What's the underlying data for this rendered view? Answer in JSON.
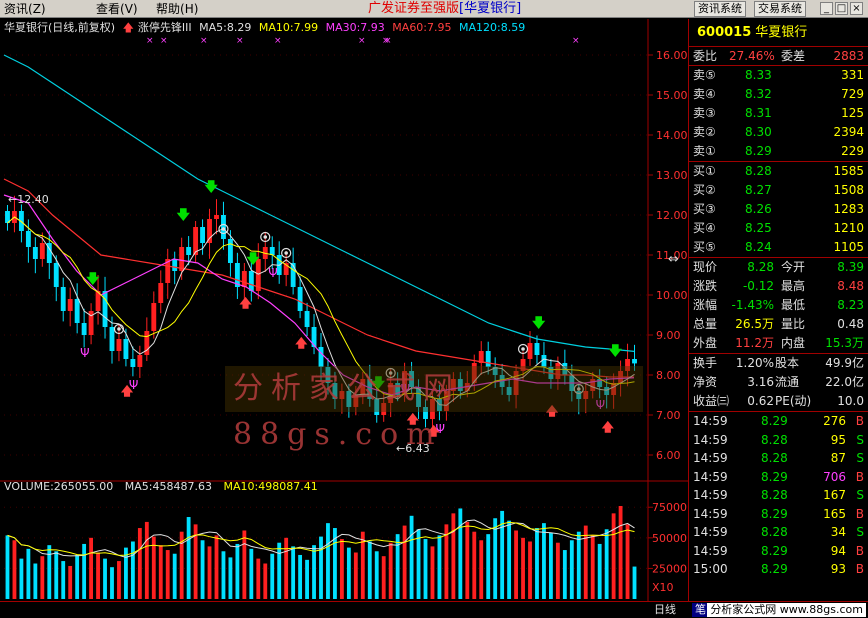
{
  "menubar": {
    "menus": [
      "资讯",
      "查看",
      "帮助"
    ],
    "menu_keys": [
      "(Z)",
      "(V)",
      "(H)"
    ],
    "banner": "广发证券至强版",
    "banner_stock": "[华夏银行]",
    "buttons": [
      "资讯系统",
      "交易系统"
    ],
    "win_buttons": [
      "_",
      "□",
      "×"
    ]
  },
  "chart": {
    "header": {
      "title": "华夏银行(日线,前复权)",
      "indicator": "涨停先锋III",
      "ma5": "MA5:8.29",
      "ma10": "MA10:7.99",
      "ma30": "MA30:7.93",
      "ma60": "MA60:7.95",
      "ma120": "MA120:8.59"
    },
    "price_axis": [
      "16.00",
      "15.00",
      "14.00",
      "13.00",
      "12.00",
      "11.00",
      "10.00",
      "9.00",
      "8.00",
      "7.00",
      "6.00"
    ],
    "high_label": "12.40",
    "low_label": "6.43",
    "volume_header": {
      "volume": "VOLUME:265055.00",
      "ma5": "MA5:458487.63",
      "ma10": "MA10:498087.41"
    },
    "volume_axis": [
      "75000",
      "50000",
      "25000"
    ],
    "volume_unit": "X10",
    "time_axis": [
      "2008年",
      "7",
      "8",
      "9",
      "10",
      "11",
      "12",
      "1"
    ],
    "watermark": "分析家公式网 88gs.com",
    "colors": {
      "up": "#ff2020",
      "down": "#00e0ff",
      "ma5": "#e0e0e0",
      "ma10": "#ffff00",
      "ma30": "#ff40ff",
      "ma60": "#ff3030",
      "ma120": "#00d0e0"
    }
  },
  "chart_data": {
    "type": "candlestick",
    "title": "华夏银行(日线,前复权)",
    "ylim": [
      5.6,
      16.5
    ],
    "high": 12.4,
    "low": 6.43,
    "ma_values": {
      "MA5": 8.29,
      "MA10": 7.99,
      "MA30": 7.93,
      "MA60": 7.95,
      "MA120": 8.59
    },
    "close_series": [
      11.8,
      12.1,
      11.6,
      11.2,
      10.9,
      11.3,
      10.8,
      10.2,
      9.6,
      9.9,
      9.3,
      9.0,
      9.6,
      10.1,
      9.2,
      8.6,
      8.9,
      8.4,
      8.2,
      8.5,
      9.1,
      9.8,
      10.3,
      10.9,
      10.6,
      11.2,
      11.0,
      11.7,
      11.3,
      11.9,
      12.0,
      11.4,
      10.8,
      10.2,
      10.6,
      10.1,
      10.9,
      11.2,
      11.0,
      10.5,
      10.8,
      10.2,
      9.6,
      9.2,
      8.7,
      8.2,
      7.8,
      7.4,
      7.6,
      7.2,
      7.5,
      7.9,
      7.4,
      7.0,
      7.3,
      7.8,
      7.5,
      8.1,
      7.7,
      7.2,
      6.9,
      7.4,
      7.1,
      7.6,
      7.9,
      7.6,
      7.8,
      8.3,
      8.6,
      8.2,
      8.0,
      7.7,
      7.5,
      8.1,
      8.4,
      8.8,
      8.5,
      8.2,
      7.9,
      8.3,
      8.0,
      7.6,
      7.4,
      7.6,
      7.9,
      7.7,
      7.5,
      7.8,
      8.1,
      8.4,
      8.29
    ],
    "ma120_series": [
      16.0,
      15.7,
      15.3,
      14.9,
      14.5,
      14.1,
      13.7,
      13.3,
      12.9,
      12.6,
      12.3,
      12.0,
      11.7,
      11.4,
      11.1,
      10.8,
      10.5,
      10.2,
      9.9,
      9.6,
      9.3,
      9.1,
      8.9,
      8.8,
      8.7,
      8.65,
      8.59
    ],
    "ma60_series": [
      12.9,
      12.6,
      12.0,
      11.5,
      11.0,
      10.9,
      10.8,
      10.7,
      10.6,
      10.5,
      10.3,
      10.1,
      9.9,
      9.6,
      9.3,
      9.0,
      8.8,
      8.6,
      8.5,
      8.4,
      8.3,
      8.2,
      8.1,
      8.0,
      8.0,
      7.95,
      7.95
    ],
    "ma30_series": [
      12.5,
      12.3,
      11.4,
      10.6,
      10.0,
      10.3,
      10.6,
      10.9,
      10.8,
      10.4,
      10.2,
      9.8,
      9.3,
      8.6,
      8.0,
      7.7,
      7.5,
      7.7,
      7.6,
      7.7,
      7.8,
      7.9,
      7.8,
      7.8,
      7.8,
      7.9,
      7.93
    ],
    "volume_series": [
      52000,
      48000,
      33000,
      41000,
      29000,
      35000,
      44000,
      39000,
      31000,
      27000,
      36000,
      45000,
      50000,
      38000,
      33000,
      26000,
      31000,
      42000,
      47000,
      58000,
      63000,
      51000,
      44000,
      40000,
      37000,
      55000,
      67000,
      61000,
      48000,
      43000,
      52000,
      39000,
      34000,
      45000,
      56000,
      41000,
      33000,
      29000,
      37000,
      46000,
      50000,
      43000,
      36000,
      32000,
      44000,
      51000,
      62000,
      58000,
      49000,
      42000,
      38000,
      55000,
      47000,
      39000,
      35000,
      46000,
      53000,
      60000,
      68000,
      57000,
      49000,
      43000,
      52000,
      61000,
      70000,
      74000,
      63000,
      55000,
      48000,
      53000,
      66000,
      72000,
      64000,
      56000,
      50000,
      47000,
      58000,
      62000,
      54000,
      46000,
      40000,
      48000,
      55000,
      60000,
      52000,
      45000,
      57000,
      70000,
      76000,
      61000,
      26505
    ]
  },
  "quote": {
    "code": "600015",
    "name": "华夏银行",
    "weibi_label": "委比",
    "weibi": "27.46%",
    "weicha_label": "委差",
    "weicha": "2883",
    "sell": [
      {
        "label": "卖⑤",
        "price": "8.33",
        "vol": "331"
      },
      {
        "label": "卖④",
        "price": "8.32",
        "vol": "729"
      },
      {
        "label": "卖③",
        "price": "8.31",
        "vol": "125"
      },
      {
        "label": "卖②",
        "price": "8.30",
        "vol": "2394"
      },
      {
        "label": "卖①",
        "price": "8.29",
        "vol": "229"
      }
    ],
    "buy": [
      {
        "label": "买①",
        "price": "8.28",
        "vol": "1585"
      },
      {
        "label": "买②",
        "price": "8.27",
        "vol": "1508"
      },
      {
        "label": "买③",
        "price": "8.26",
        "vol": "1283"
      },
      {
        "label": "买④",
        "price": "8.25",
        "vol": "1210"
      },
      {
        "label": "买⑤",
        "price": "8.24",
        "vol": "1105"
      }
    ],
    "stats": [
      {
        "l1": "现价",
        "v1": "8.28",
        "c1": "#00e000",
        "l2": "今开",
        "v2": "8.39",
        "c2": "#00e000"
      },
      {
        "l1": "涨跌",
        "v1": "-0.12",
        "c1": "#00e000",
        "l2": "最高",
        "v2": "8.48",
        "c2": "#ff4040"
      },
      {
        "l1": "涨幅",
        "v1": "-1.43%",
        "c1": "#00e000",
        "l2": "最低",
        "v2": "8.23",
        "c2": "#00e000"
      },
      {
        "l1": "总量",
        "v1": "26.5万",
        "c1": "#ffff00",
        "l2": "量比",
        "v2": "0.48",
        "c2": "#e0e0e0"
      },
      {
        "l1": "外盘",
        "v1": "11.2万",
        "c1": "#ff4040",
        "l2": "内盘",
        "v2": "15.3万",
        "c2": "#00e000"
      }
    ],
    "stats2": [
      {
        "l1": "换手",
        "v1": "1.20%",
        "l2": "股本",
        "v2": "49.9亿"
      },
      {
        "l1": "净资",
        "v1": "3.16",
        "l2": "流通",
        "v2": "22.0亿"
      },
      {
        "l1": "收益㈢",
        "v1": "0.62",
        "l2": "PE(动)",
        "v2": "10.0"
      }
    ],
    "ticks": [
      {
        "time": "14:59",
        "price": "8.29",
        "vol": "276",
        "bs": "B"
      },
      {
        "time": "14:59",
        "price": "8.28",
        "vol": "95",
        "bs": "S"
      },
      {
        "time": "14:59",
        "price": "8.28",
        "vol": "87",
        "bs": "S"
      },
      {
        "time": "14:59",
        "price": "8.29",
        "vol": "706",
        "bs": "B"
      },
      {
        "time": "14:59",
        "price": "8.28",
        "vol": "167",
        "bs": "S"
      },
      {
        "time": "14:59",
        "price": "8.29",
        "vol": "165",
        "bs": "B"
      },
      {
        "time": "14:59",
        "price": "8.28",
        "vol": "34",
        "bs": "S"
      },
      {
        "time": "14:59",
        "price": "8.29",
        "vol": "94",
        "bs": "B"
      },
      {
        "time": "15:00",
        "price": "8.29",
        "vol": "93",
        "bs": "B"
      }
    ]
  },
  "bottom": {
    "tab_day": "日线",
    "tab_tick": "笔",
    "site": "分析家公式网 www.88gs.com"
  }
}
